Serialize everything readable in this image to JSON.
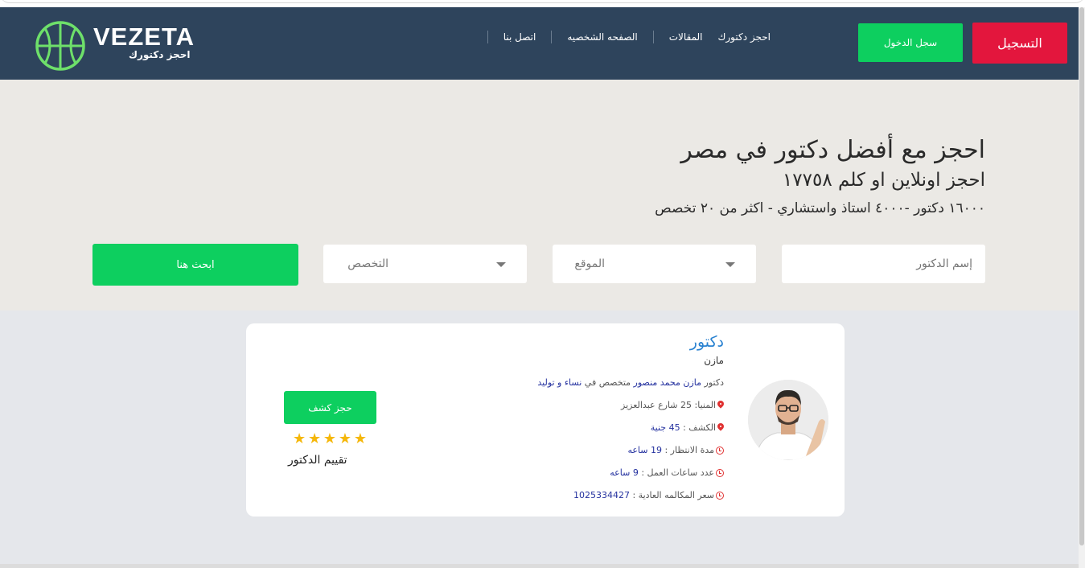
{
  "navbar": {
    "logo_title": "VEZETA",
    "logo_subtitle": "احجز دكتورك",
    "links": [
      "اتصل بنا",
      "الصفحه الشخصيه",
      "المقالات",
      "احجز دكتورك"
    ],
    "login_label": "سجل الدخول",
    "register_label": "التسجيل"
  },
  "hero": {
    "title": "احجز مع أفضل دكتور في مصر",
    "subtitle": "احجز اونلاين او كلم ١٧٧٥٨",
    "stats": "١٦٠٠٠ دكتور -٤٠٠٠ استاذ واستشاري - اكثر من ٢٠ تخصص"
  },
  "search": {
    "name_placeholder": "إسم الدكتور",
    "location_placeholder": "الموقع",
    "specialty_placeholder": "التخصص",
    "button_label": "ابحث هنا"
  },
  "doctor_card": {
    "title": "دكتور",
    "name": "مازن",
    "desc_prefix": "دكتور",
    "full_name": "مازن محمد منصور",
    "desc_mid": "متخصص في",
    "specialty": "نساء و توليد",
    "address": "المنيا: 25 شارع عبدالعزيز",
    "fee_label": "الكشف :",
    "fee_value": "45 جنية",
    "wait_label": "مدة الانتظار :",
    "wait_value": "19 ساعه",
    "hours_label": "عدد ساعات العمل :",
    "hours_value": "9 ساعه",
    "phone_label": "سعر المكالمه العادية :",
    "phone_value": "1025334427",
    "book_label": "حجز كشف",
    "rating": 5,
    "rating_label": "تقييم الدكتور"
  },
  "colors": {
    "navbar": "#2e445c",
    "green": "#0dcf5f",
    "red": "#e3163d",
    "hero_bg": "#ebe9e5",
    "link_blue": "#24319f",
    "title_blue": "#2b83d1",
    "star": "#f5b70a"
  },
  "icons": [
    "basketball-logo-icon",
    "map-pin-icon",
    "clock-icon",
    "star-icon",
    "chevron-down-icon"
  ]
}
